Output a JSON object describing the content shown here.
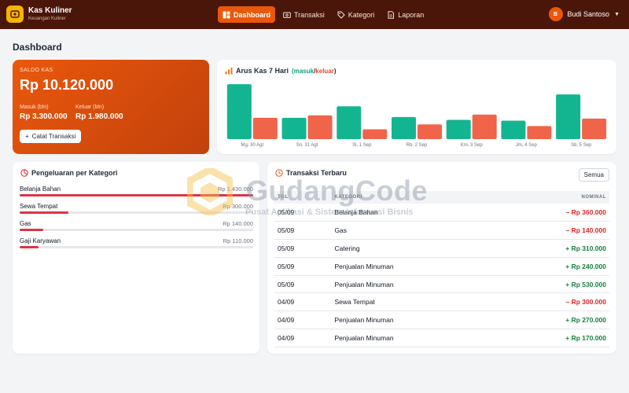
{
  "app": {
    "title": "Kas Kuliner",
    "subtitle": "Keuangan Kuliner"
  },
  "nav": [
    {
      "label": "Dashboard",
      "icon": "dashboard-icon",
      "active": true
    },
    {
      "label": "Transaksi",
      "icon": "wallet-icon",
      "active": false
    },
    {
      "label": "Kategori",
      "icon": "tag-icon",
      "active": false
    },
    {
      "label": "Laporan",
      "icon": "report-icon",
      "active": false
    }
  ],
  "user": {
    "initial": "B",
    "name": "Budi Santoso"
  },
  "page_title": "Dashboard",
  "saldo": {
    "label": "SALDO KAS",
    "value": "Rp 10.120.000",
    "masuk_label": "Masuk (bln)",
    "masuk_value": "Rp 3.300.000",
    "keluar_label": "Keluar (bln)",
    "keluar_value": "Rp 1.980.000",
    "button_label": "Catat Transaksi"
  },
  "arus": {
    "title": "Arus Kas 7 Hari",
    "legend_open": "(",
    "legend_in": "masuk",
    "legend_sep": "/",
    "legend_out": "keluar",
    "legend_close": ")"
  },
  "chart_data": {
    "type": "bar",
    "categories": [
      "Mg, 30 Agt",
      "Sn, 31 Agt",
      "Sl, 1 Sep",
      "Rb, 2 Sep",
      "Km, 3 Sep",
      "Jm, 4 Sep",
      "Sb, 5 Sep"
    ],
    "series": [
      {
        "name": "masuk",
        "values": [
          670,
          260,
          400,
          270,
          235,
          225,
          545
        ],
        "color": "#13b590"
      },
      {
        "name": "keluar",
        "values": [
          260,
          290,
          120,
          180,
          300,
          160,
          250
        ],
        "color": "#f0644a"
      }
    ],
    "ylim": [
      0,
      700
    ],
    "grid": false
  },
  "kategori": {
    "title": "Pengeluaran per Kategori",
    "items": [
      {
        "name": "Belanja Bahan",
        "amount": "Rp 1.430.000",
        "share": 1.0
      },
      {
        "name": "Sewa Tempat",
        "amount": "Rp 300.000",
        "share": 0.21
      },
      {
        "name": "Gas",
        "amount": "Rp 140.000",
        "share": 0.1
      },
      {
        "name": "Gaji Karyawan",
        "amount": "Rp 110.000",
        "share": 0.08
      }
    ],
    "bar_color": "#dc3545"
  },
  "transaksi": {
    "title": "Transaksi Terbaru",
    "button_label": "Semua",
    "columns": [
      "TGL",
      "KATEGORI",
      "NOMINAL"
    ],
    "rows": [
      {
        "date": "05/09",
        "category": "Belanja Bahan",
        "amount": "– Rp 360.000",
        "type": "out"
      },
      {
        "date": "05/09",
        "category": "Gas",
        "amount": "– Rp 140.000",
        "type": "out"
      },
      {
        "date": "05/09",
        "category": "Catering",
        "amount": "+ Rp 310.000",
        "type": "in"
      },
      {
        "date": "05/09",
        "category": "Penjualan Minuman",
        "amount": "+ Rp 240.000",
        "type": "in"
      },
      {
        "date": "05/09",
        "category": "Penjualan Minuman",
        "amount": "+ Rp 530.000",
        "type": "in"
      },
      {
        "date": "04/09",
        "category": "Sewa Tempat",
        "amount": "– Rp 300.000",
        "type": "out"
      },
      {
        "date": "04/09",
        "category": "Penjualan Minuman",
        "amount": "+ Rp 270.000",
        "type": "in"
      },
      {
        "date": "04/09",
        "category": "Penjualan Minuman",
        "amount": "+ Rp 170.000",
        "type": "in"
      }
    ]
  },
  "watermark": {
    "title": "GudangCode",
    "subtitle": "Pusat Aplikasi & Sistem Informasi Bisnis"
  }
}
